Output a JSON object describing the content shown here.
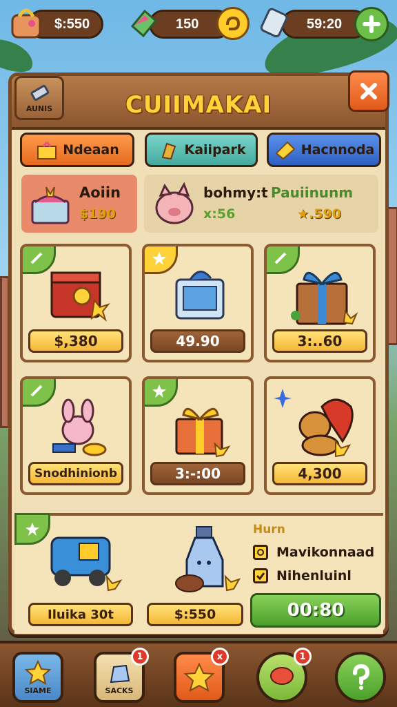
{
  "top_bar": {
    "coins": "$:550",
    "energy": "150",
    "timer": "59:20"
  },
  "shop": {
    "title": "CUIIMAKAI",
    "label_button": "AUNIS",
    "close_icon": "close-icon"
  },
  "tabs": [
    {
      "label": "Ndeaan",
      "color": "#f08a3a",
      "icon": "gift-icon"
    },
    {
      "label": "Kaiipark",
      "color": "#58c1b8",
      "icon": "coin-bag-icon"
    },
    {
      "label": "Hacnnoda",
      "color": "#3f78d9",
      "icon": "ticket-icon"
    }
  ],
  "featured": [
    {
      "title": "Aoiin",
      "price": "$190"
    },
    {
      "title": "bohmy:t",
      "subtitle": "Pauiinunm",
      "price_left": "x:56",
      "price_right": "★.590"
    }
  ],
  "cards": [
    {
      "price": "$,380",
      "style": "yellow",
      "item": "red-chest"
    },
    {
      "price": "49.90",
      "style": "brown",
      "item": "blue-box"
    },
    {
      "price": "3:..60",
      "style": "yellow",
      "item": "gift-box-blue-ribbon"
    },
    {
      "price": "Snodhinionb",
      "style": "yellow",
      "item": "pink-bunny"
    },
    {
      "price": "3:-:00",
      "style": "brown",
      "item": "orange-gift"
    },
    {
      "price": "4,300",
      "style": "yellow",
      "item": "orange-creature"
    }
  ],
  "bottom": {
    "item1_price": "Iluika 30t",
    "item2_price": "$:550",
    "heading": "Hurn",
    "option1": "Mavikonnaad",
    "option2": "Nihenluinl",
    "buy_label": "00:80"
  },
  "nav": [
    {
      "label": "SIAME",
      "badge": ""
    },
    {
      "label": "SACKS",
      "badge": "1"
    },
    {
      "label": "",
      "badge": "x"
    },
    {
      "label": "",
      "badge": "1"
    },
    {
      "label": "",
      "badge": ""
    }
  ]
}
